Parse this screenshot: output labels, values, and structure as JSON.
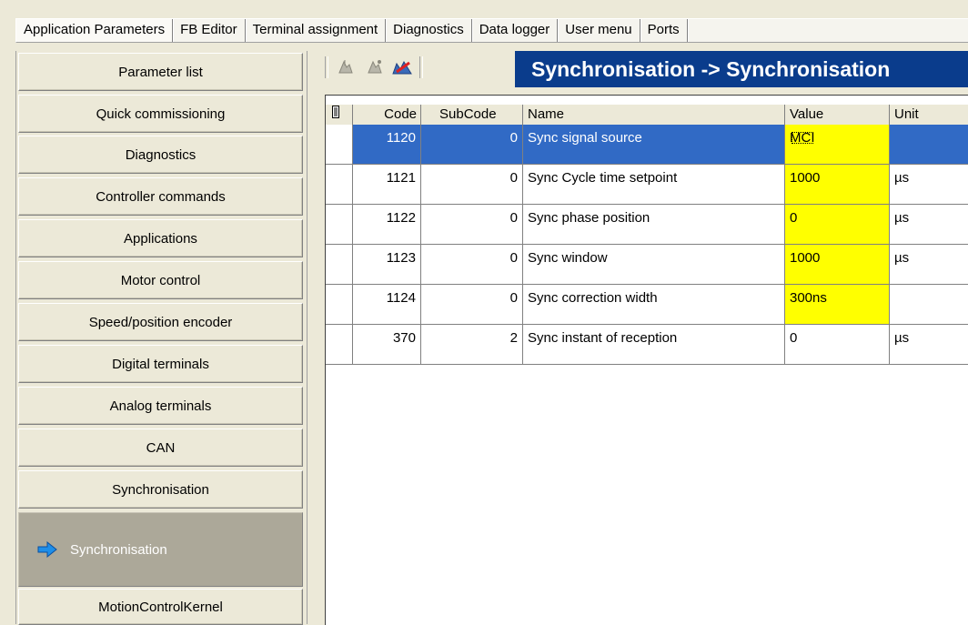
{
  "tabs": [
    "Application Parameters",
    "FB Editor",
    "Terminal assignment",
    "Diagnostics",
    "Data logger",
    "User menu",
    "Ports"
  ],
  "nav": {
    "items": [
      "Parameter list",
      "Quick commissioning",
      "Diagnostics",
      "Controller commands",
      "Applications",
      "Motor control",
      "Speed/position encoder",
      "Digital terminals",
      "Analog terminals",
      "CAN",
      "Synchronisation",
      "Synchronisation",
      "MotionControlKernel"
    ],
    "selected_index": 11
  },
  "toolbar": {
    "icons": [
      "upload-icon",
      "download-icon",
      "compare-icon"
    ],
    "banner": "Synchronisation -> Synchronisation"
  },
  "grid": {
    "columns": [
      "Code",
      "SubCode",
      "Name",
      "Value",
      "Unit"
    ],
    "rows": [
      {
        "code": "1120",
        "sub": "0",
        "name": "Sync signal source",
        "value": "MCI",
        "unit": "",
        "selected": true,
        "editable": true
      },
      {
        "code": "1121",
        "sub": "0",
        "name": "Sync Cycle time setpoint",
        "value": "1000",
        "unit": "µs",
        "selected": false,
        "editable": true
      },
      {
        "code": "1122",
        "sub": "0",
        "name": "Sync phase position",
        "value": "0",
        "unit": "µs",
        "selected": false,
        "editable": true
      },
      {
        "code": "1123",
        "sub": "0",
        "name": "Sync window",
        "value": "1000",
        "unit": "µs",
        "selected": false,
        "editable": true
      },
      {
        "code": "1124",
        "sub": "0",
        "name": "Sync correction width",
        "value": "300ns",
        "unit": "",
        "selected": false,
        "editable": true
      },
      {
        "code": "370",
        "sub": "2",
        "name": "Sync instant of reception",
        "value": "0",
        "unit": "µs",
        "selected": false,
        "editable": false
      }
    ]
  },
  "colors": {
    "banner": "#0a3c8c",
    "selection": "#316ac5",
    "editable": "#ffff00"
  }
}
